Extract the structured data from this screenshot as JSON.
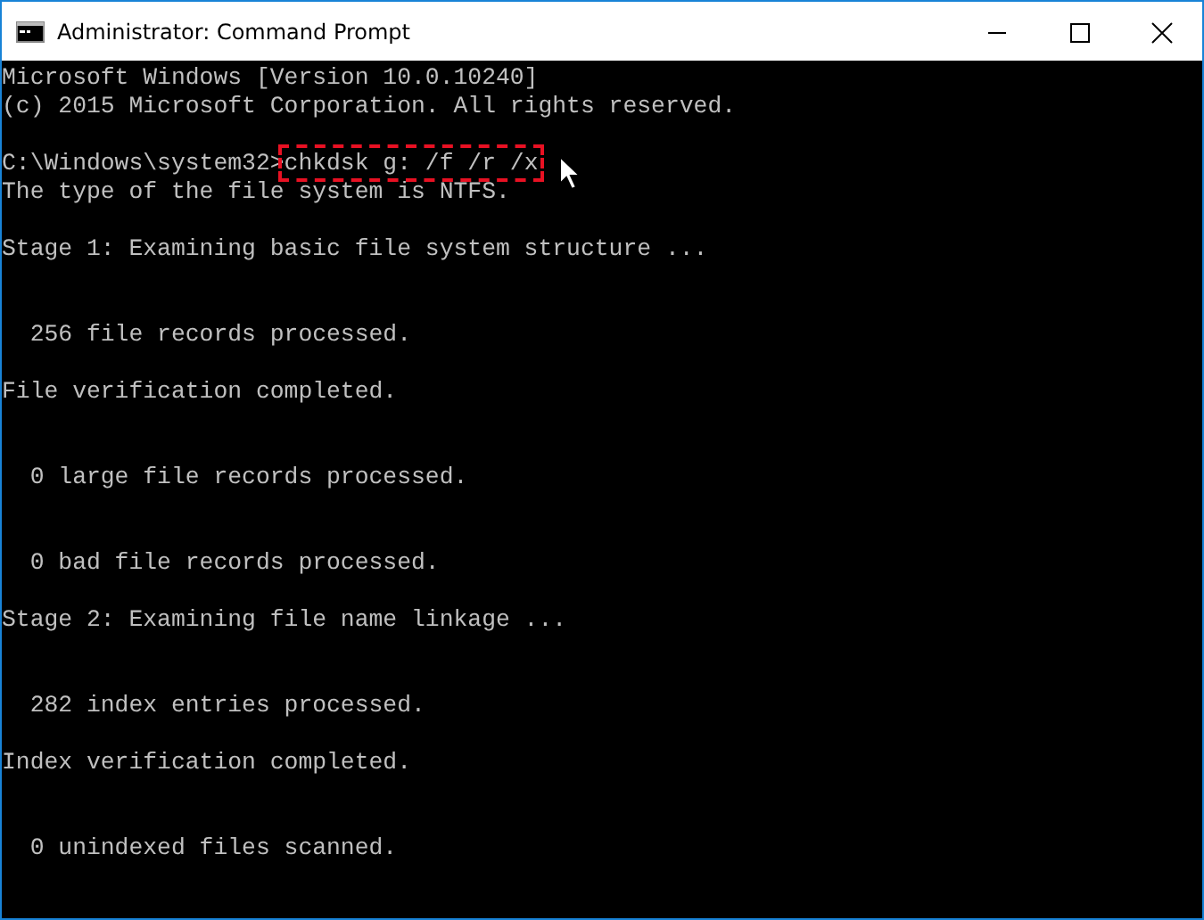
{
  "window": {
    "title": "Administrator: Command Prompt"
  },
  "console": {
    "lines": [
      {
        "kind": "text",
        "text": "Microsoft Windows [Version 10.0.10240]"
      },
      {
        "kind": "text",
        "text": "(c) 2015 Microsoft Corporation. All rights reserved."
      },
      {
        "kind": "blank"
      },
      {
        "kind": "command",
        "prompt": "C:\\Windows\\system32>",
        "command": "chkdsk g: /f /r /x"
      },
      {
        "kind": "text",
        "text": "The type of the file system is NTFS."
      },
      {
        "kind": "blank"
      },
      {
        "kind": "text",
        "text": "Stage 1: Examining basic file system structure ..."
      },
      {
        "kind": "blank"
      },
      {
        "kind": "blank"
      },
      {
        "kind": "text",
        "text": "  256 file records processed."
      },
      {
        "kind": "blank"
      },
      {
        "kind": "text",
        "text": "File verification completed."
      },
      {
        "kind": "blank"
      },
      {
        "kind": "blank"
      },
      {
        "kind": "text",
        "text": "  0 large file records processed."
      },
      {
        "kind": "blank"
      },
      {
        "kind": "blank"
      },
      {
        "kind": "text",
        "text": "  0 bad file records processed."
      },
      {
        "kind": "blank"
      },
      {
        "kind": "text",
        "text": "Stage 2: Examining file name linkage ..."
      },
      {
        "kind": "blank"
      },
      {
        "kind": "blank"
      },
      {
        "kind": "text",
        "text": "  282 index entries processed."
      },
      {
        "kind": "blank"
      },
      {
        "kind": "text",
        "text": "Index verification completed."
      },
      {
        "kind": "blank"
      },
      {
        "kind": "blank"
      },
      {
        "kind": "text",
        "text": "  0 unindexed files scanned."
      }
    ]
  }
}
